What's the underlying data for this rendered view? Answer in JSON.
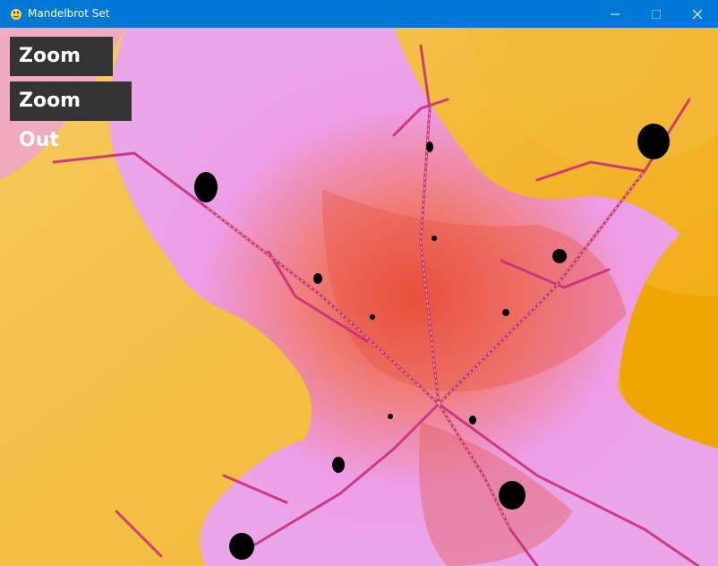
{
  "window": {
    "title": "Mandelbrot Set"
  },
  "controls": {
    "zoom_in_label": "Zoom In",
    "zoom_out_label": "Zoom Out"
  },
  "icons": {
    "app": "python-icon",
    "minimize": "minimize-icon",
    "maximize": "maximize-icon",
    "close": "close-icon"
  },
  "colors": {
    "titlebar": "#0078d7",
    "button_bg": "#333333",
    "set": "#000000",
    "outer": "#f2bb40",
    "halo": "#eea0ea",
    "filament": "#c8307a"
  }
}
